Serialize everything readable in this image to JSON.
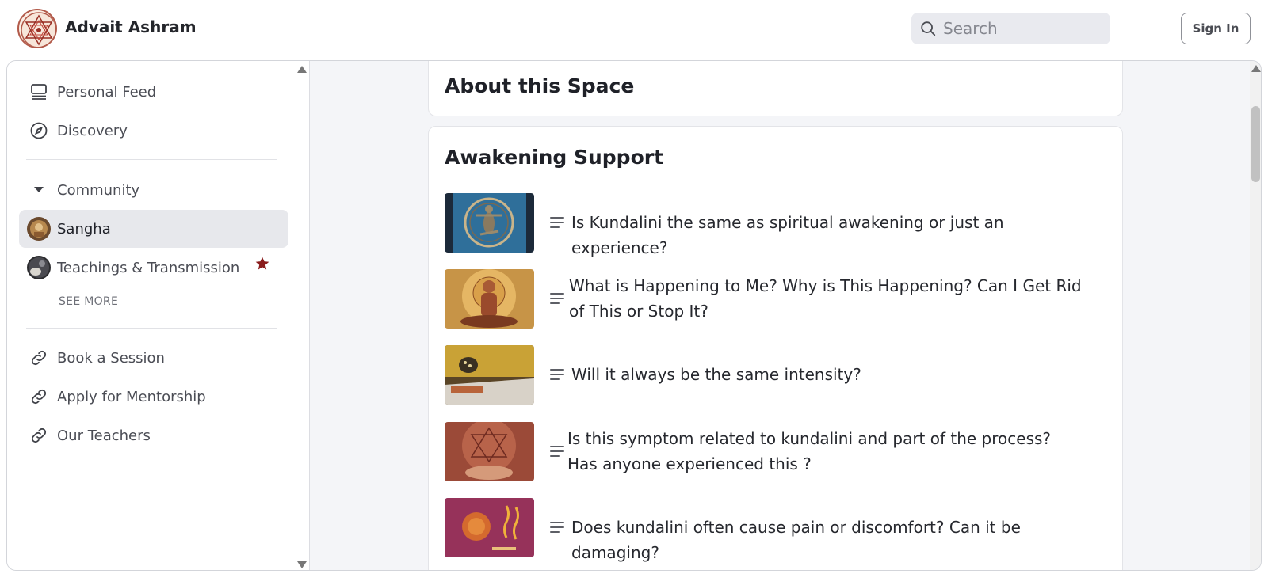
{
  "header": {
    "brand": "Advait Ashram",
    "search_placeholder": "Search",
    "signin_label": "Sign In"
  },
  "sidebar": {
    "items_top": [
      {
        "label": "Personal Feed",
        "icon": "feed-icon"
      },
      {
        "label": "Discovery",
        "icon": "compass-icon"
      }
    ],
    "community_label": "Community",
    "spaces": [
      {
        "label": "Sangha",
        "active": true
      },
      {
        "label": "Teachings & Transmission",
        "starred": true
      }
    ],
    "see_more": "SEE MORE",
    "links": [
      {
        "label": "Book a Session",
        "icon": "link-icon"
      },
      {
        "label": "Apply for Mentorship",
        "icon": "link-icon"
      },
      {
        "label": "Our Teachers",
        "icon": "link-icon"
      }
    ]
  },
  "main": {
    "about_title": "About this Space",
    "section_title": "Awakening Support",
    "posts": [
      {
        "title": "Is Kundalini the same as spiritual awakening or just an experience?"
      },
      {
        "title": "What is Happening to Me? Why is This Happening? Can I Get Rid of This or Stop It?"
      },
      {
        "title": "Will it always be the same intensity?"
      },
      {
        "title": "Is this symptom related to kundalini and part of the process? Has anyone experienced this ?"
      },
      {
        "title": "Does kundalini often cause pain or discomfort? Can it be damaging?"
      }
    ]
  },
  "colors": {
    "accent_star": "#8a1c1c",
    "active_bg": "#e7e8ec",
    "page_bg": "#f4f5f8"
  }
}
